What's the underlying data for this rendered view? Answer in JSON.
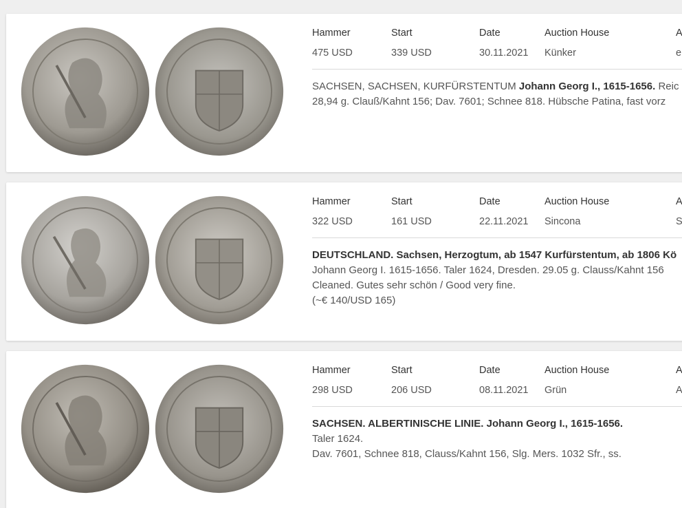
{
  "columns": {
    "hammer": "Hammer",
    "start": "Start",
    "date": "Date",
    "auction_house": "Auction House",
    "cut": "A"
  },
  "results": [
    {
      "hammer": "475 USD",
      "start": "339 USD",
      "date": "30.11.2021",
      "auction_house": "Künker",
      "cut_value": "e",
      "desc_plain_1": "SACHSEN, SACHSEN, KURFÜRSTENTUM ",
      "desc_bold_1": "Johann Georg I., 1615-1656.",
      "desc_plain_1b": " Reic",
      "desc_line_2": "28,94 g. Clauß/Kahnt 156; Dav. 7601; Schnee 818. Hübsche Patina, fast vorz",
      "desc_line_3": "",
      "desc_line_4": ""
    },
    {
      "hammer": "322 USD",
      "start": "161 USD",
      "date": "22.11.2021",
      "auction_house": "Sincona",
      "cut_value": "S",
      "desc_plain_1": "",
      "desc_bold_1": "DEUTSCHLAND. Sachsen, Herzogtum, ab 1547 Kurfürstentum, ab 1806 Kö",
      "desc_plain_1b": "",
      "desc_line_2": "Johann Georg I. 1615-1656. Taler 1624, Dresden. 29.05 g. Clauss/Kahnt 156",
      "desc_line_3": "Cleaned. Gutes sehr schön / Good very fine.",
      "desc_line_4": "(~€ 140/USD 165)"
    },
    {
      "hammer": "298 USD",
      "start": "206 USD",
      "date": "08.11.2021",
      "auction_house": "Grün",
      "cut_value": "A",
      "desc_plain_1": "",
      "desc_bold_1": "SACHSEN. ALBERTINISCHE LINIE. Johann Georg I., 1615-1656.",
      "desc_plain_1b": "",
      "desc_line_2": "Taler 1624.",
      "desc_line_3": "Dav. 7601, Schnee 818, Clauss/Kahnt 156, Slg. Mers. 1032 Sfr., ss.",
      "desc_line_4": ""
    }
  ]
}
